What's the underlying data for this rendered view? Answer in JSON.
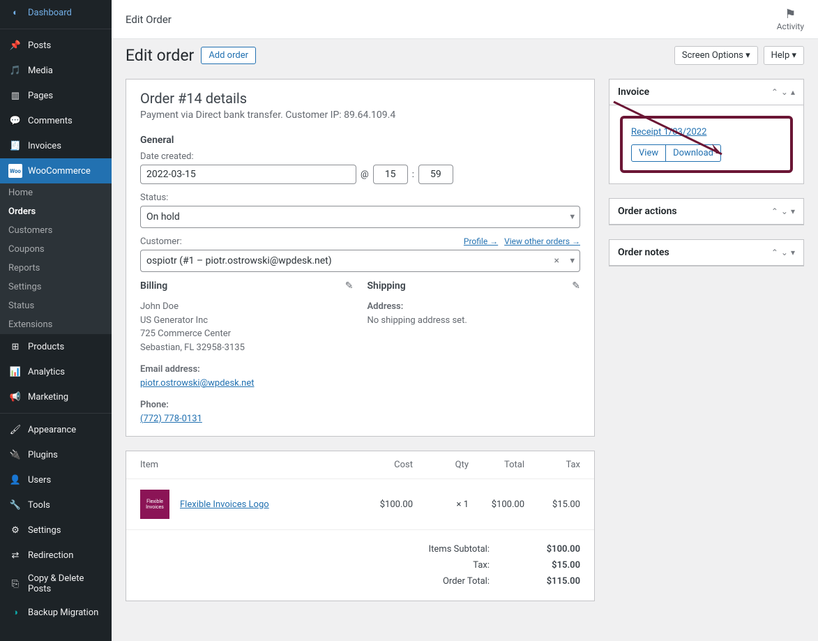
{
  "topbar": {
    "title": "Edit Order",
    "activity": "Activity"
  },
  "sidebar": {
    "items": [
      {
        "label": "Dashboard"
      },
      {
        "label": "Posts"
      },
      {
        "label": "Media"
      },
      {
        "label": "Pages"
      },
      {
        "label": "Comments"
      },
      {
        "label": "Invoices"
      },
      {
        "label": "WooCommerce"
      }
    ],
    "woo_sub": [
      {
        "label": "Home"
      },
      {
        "label": "Orders"
      },
      {
        "label": "Customers"
      },
      {
        "label": "Coupons"
      },
      {
        "label": "Reports"
      },
      {
        "label": "Settings"
      },
      {
        "label": "Status"
      },
      {
        "label": "Extensions"
      }
    ],
    "items2": [
      {
        "label": "Products"
      },
      {
        "label": "Analytics"
      },
      {
        "label": "Marketing"
      }
    ],
    "items3": [
      {
        "label": "Appearance"
      },
      {
        "label": "Plugins"
      },
      {
        "label": "Users"
      },
      {
        "label": "Tools"
      },
      {
        "label": "Settings"
      },
      {
        "label": "Redirection"
      },
      {
        "label": "Copy & Delete Posts"
      },
      {
        "label": "Backup Migration"
      }
    ]
  },
  "header": {
    "title": "Edit order",
    "add_order": "Add order",
    "screen_options": "Screen Options",
    "help": "Help"
  },
  "order": {
    "title": "Order #14 details",
    "subtitle": "Payment via Direct bank transfer. Customer IP: 89.64.109.4",
    "general_label": "General",
    "date_created_label": "Date created:",
    "date": "2022-03-15",
    "at": "@",
    "hour": "15",
    "colon": ":",
    "minute": "59",
    "status_label": "Status:",
    "status_value": "On hold",
    "customer_label": "Customer:",
    "profile_link": "Profile →",
    "view_orders_link": "View other orders →",
    "customer_value": "ospiotr (#1 – piotr.ostrowski@wpdesk.net)",
    "billing_label": "Billing",
    "shipping_label": "Shipping",
    "billing_name": "John Doe",
    "billing_company": "US Generator Inc",
    "billing_street": "725 Commerce Center",
    "billing_city": "Sebastian, FL 32958-3135",
    "email_label": "Email address:",
    "email": "piotr.ostrowski@wpdesk.net",
    "phone_label": "Phone:",
    "phone": "(772) 778-0131",
    "shipping_addr_label": "Address:",
    "no_shipping": "No shipping address set."
  },
  "items": {
    "headers": {
      "item": "Item",
      "cost": "Cost",
      "qty": "Qty",
      "total": "Total",
      "tax": "Tax"
    },
    "row": {
      "name": "Flexible Invoices Logo",
      "cost": "$100.00",
      "qty": "× 1",
      "total": "$100.00",
      "tax": "$15.00"
    },
    "totals": {
      "subtotal_label": "Items Subtotal:",
      "subtotal": "$100.00",
      "tax_label": "Tax:",
      "tax": "$15.00",
      "order_total_label": "Order Total:",
      "order_total": "$115.00"
    }
  },
  "invoice": {
    "title": "Invoice",
    "receipt": "Receipt 1/03/2022",
    "view": "View",
    "download": "Download"
  },
  "actions": {
    "title": "Order actions"
  },
  "notes": {
    "title": "Order notes"
  }
}
